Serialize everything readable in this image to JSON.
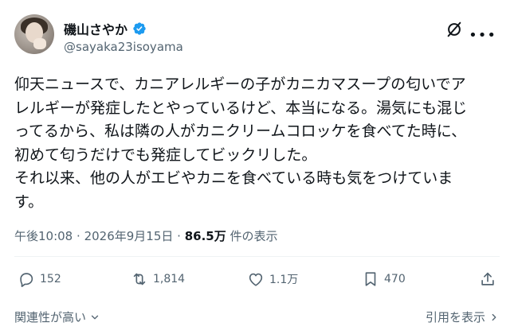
{
  "author": {
    "display_name": "磯山さやか",
    "handle": "@sayaka23isoyama",
    "verified": true
  },
  "post": {
    "lines": [
      "仰天ニュースで、カニアレルギーの子がカニカマスープの匂いでア",
      "レルギーが発症したとやっているけど、本当になる。湯気にも混じ",
      "ってるから、私は隣の人がカニクリームコロッケを食べてた時に、",
      "初めて匂うだけでも発症してビックリした。",
      "それ以来、他の人がエビやカニを食べている時も気をつけていま",
      "す。"
    ],
    "time": "午後10:08",
    "separator": "·",
    "date": "2026年9月15日",
    "views_count": "86.5万",
    "views_label": "件の表示"
  },
  "actions": {
    "replies": "152",
    "reposts": "1,814",
    "likes": "1.1万",
    "bookmarks": "470"
  },
  "footer": {
    "sort_label": "関連性が高い",
    "quotes_label": "引用を表示"
  },
  "colors": {
    "text": "#0f1419",
    "secondary": "#536471",
    "verified": "#1d9bf0"
  }
}
